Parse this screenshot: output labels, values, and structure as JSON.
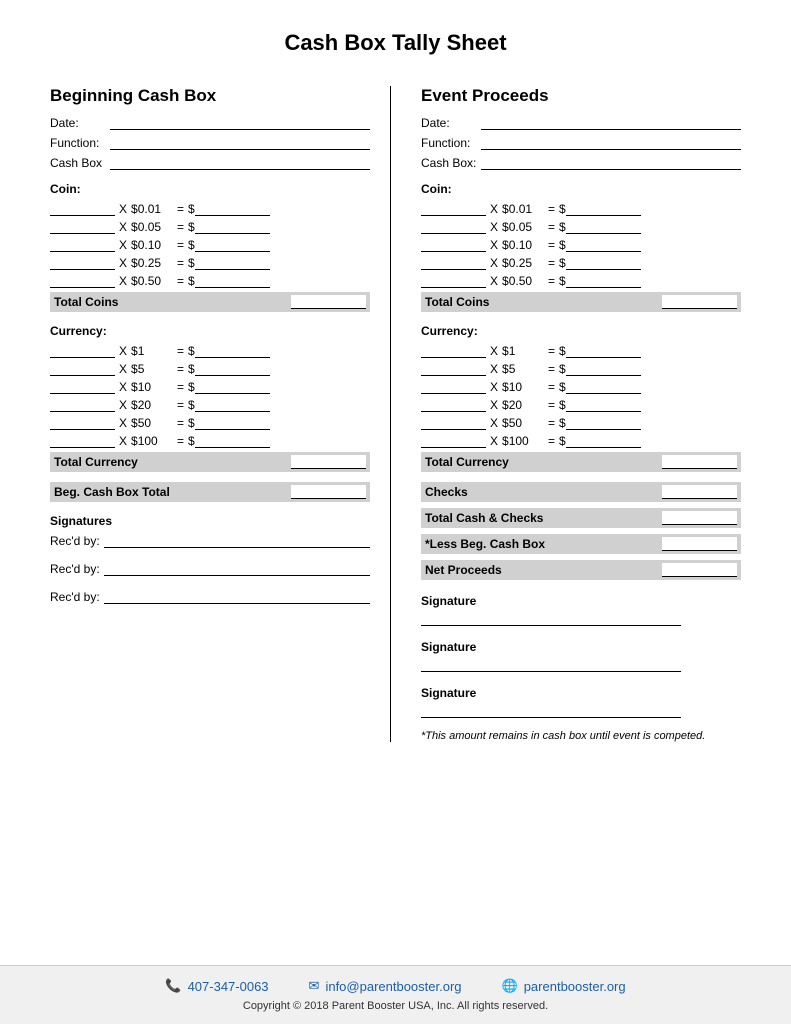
{
  "page": {
    "title": "Cash Box Tally Sheet"
  },
  "left": {
    "section_title": "Beginning Cash Box",
    "date_label": "Date:",
    "function_label": "Function:",
    "cashbox_label": "Cash Box",
    "coin_title": "Coin:",
    "coins": [
      {
        "denom": "$0.01"
      },
      {
        "denom": "$0.05"
      },
      {
        "denom": "$0.10"
      },
      {
        "denom": "$0.25"
      },
      {
        "denom": "$0.50"
      }
    ],
    "total_coins_label": "Total Coins",
    "currency_title": "Currency:",
    "currencies": [
      {
        "denom": "$1"
      },
      {
        "denom": "$5"
      },
      {
        "denom": "$10"
      },
      {
        "denom": "$20"
      },
      {
        "denom": "$50"
      },
      {
        "denom": "$100"
      }
    ],
    "total_currency_label": "Total Currency",
    "beg_cash_box_total_label": "Beg. Cash Box Total",
    "signatures_title": "Signatures",
    "recd_by_label": "Rec'd by:",
    "recd_by_label2": "Rec'd by:",
    "recd_by_label3": "Rec'd by:"
  },
  "right": {
    "section_title": "Event Proceeds",
    "date_label": "Date:",
    "function_label": "Function:",
    "cashbox_label": "Cash Box:",
    "coin_title": "Coin:",
    "coins": [
      {
        "denom": "$0.01"
      },
      {
        "denom": "$0.05"
      },
      {
        "denom": "$0.10"
      },
      {
        "denom": "$0.25"
      },
      {
        "denom": "$0.50"
      }
    ],
    "total_coins_label": "Total Coins",
    "currency_title": "Currency:",
    "currencies": [
      {
        "denom": "$1"
      },
      {
        "denom": "$5"
      },
      {
        "denom": "$10"
      },
      {
        "denom": "$20"
      },
      {
        "denom": "$50"
      },
      {
        "denom": "$100"
      }
    ],
    "total_currency_label": "Total Currency",
    "checks_label": "Checks",
    "total_cash_checks_label": "Total Cash & Checks",
    "less_beg_label": "*Less Beg. Cash Box",
    "net_proceeds_label": "Net Proceeds",
    "signature1_label": "Signature",
    "signature2_label": "Signature",
    "signature3_label": "Signature",
    "footnote": "*This amount remains in cash box until event is competed."
  },
  "footer": {
    "phone_icon": "📞",
    "phone": "407-347-0063",
    "email_icon": "✉",
    "email": "info@parentbooster.org",
    "globe_icon": "🌐",
    "website": "parentbooster.org",
    "copyright": "Copyright © 2018 Parent Booster USA, Inc. All rights reserved."
  }
}
